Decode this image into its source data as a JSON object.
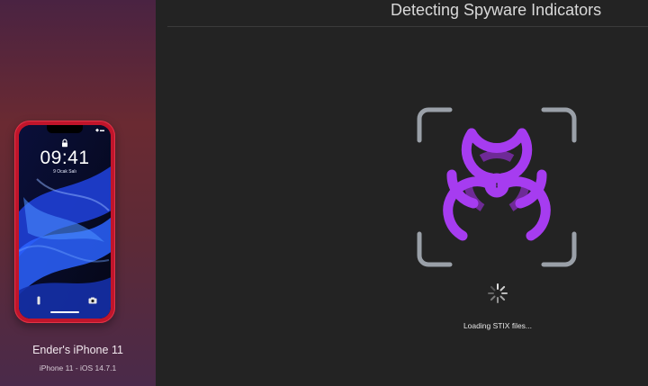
{
  "device": {
    "name": "Ender's iPhone 11",
    "info": "iPhone 11 - iOS 14.7.1",
    "lock_screen": {
      "time": "09:41",
      "date": "9 Ocak Salı"
    }
  },
  "main": {
    "title": "Detecting Spyware Indicators",
    "status": "Loading STIX files...",
    "icons": {
      "scan": "biohazard-scan-icon",
      "spinner": "loading-spinner-icon"
    }
  },
  "colors": {
    "accent": "#a63cf0",
    "accent_dark": "#6e2a96",
    "frame": "#9aa0a8",
    "phone_body": "#c0152b",
    "background": "#232323"
  }
}
